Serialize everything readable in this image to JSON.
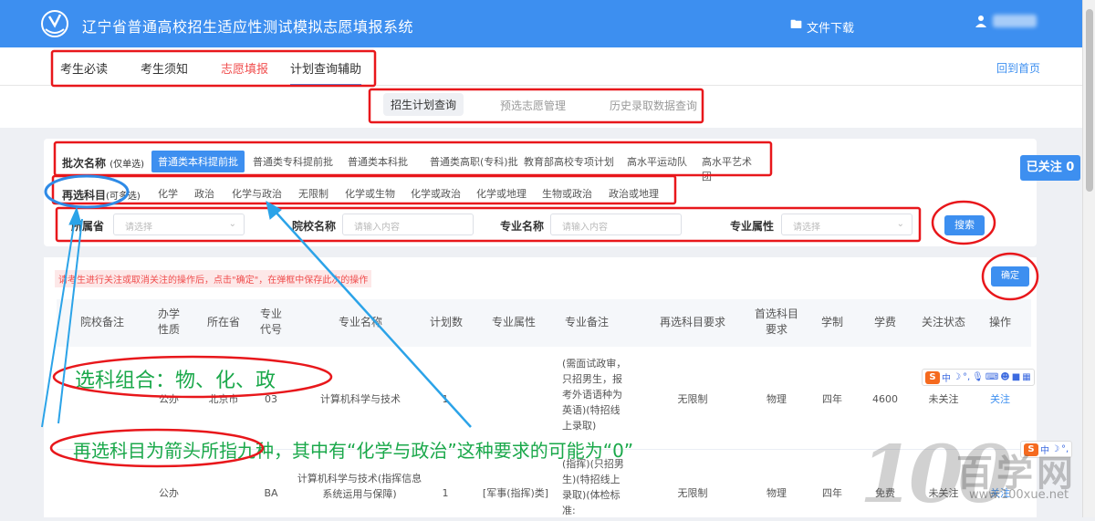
{
  "header": {
    "title": "辽宁省普通高校招生适应性测试模拟志愿填报系统",
    "file_download": "文件下载",
    "home_link": "回到首页"
  },
  "nav": {
    "items": [
      {
        "label": "考生必读"
      },
      {
        "label": "考生须知"
      },
      {
        "label": "志愿填报"
      },
      {
        "label": "计划查询辅助"
      }
    ]
  },
  "subnav": {
    "tabs": [
      {
        "label": "招生计划查询"
      },
      {
        "label": "预选志愿管理"
      },
      {
        "label": "历史录取数据查询"
      }
    ]
  },
  "filters": {
    "batch_label": "批次名称",
    "batch_hint": "(仅单选)",
    "batches": [
      "普通类本科提前批",
      "普通类专科提前批",
      "普通类本科批",
      "普通类高职(专科)批",
      "教育部高校专项计划",
      "高水平运动队",
      "高水平艺术团"
    ],
    "subject_label": "再选科目",
    "subject_hint": "(可多选)",
    "subjects": [
      "化学",
      "政治",
      "化学与政治",
      "无限制",
      "化学或生物",
      "化学或政治",
      "化学或地理",
      "生物或政治",
      "政治或地理"
    ],
    "province_label": "所属省",
    "province_placeholder": "请选择",
    "school_label": "院校名称",
    "school_placeholder": "请输入内容",
    "major_label": "专业名称",
    "major_placeholder": "请输入内容",
    "attr_label": "专业属性",
    "attr_placeholder": "请选择",
    "search_label": "搜索"
  },
  "follow_badge": "已关注 0",
  "notice": "请考生进行关注或取消关注的操作后，点击\"确定\"，在弹框中保存此次的操作",
  "confirm_label": "确定",
  "table": {
    "headers": [
      "院校备注",
      "办学性质",
      "所在省",
      "专业代号",
      "专业名称",
      "计划数",
      "专业属性",
      "专业备注",
      "再选科目要求",
      "首选科目要求",
      "学制",
      "学费",
      "关注状态",
      "操作"
    ],
    "rows": [
      {
        "nature": "公办",
        "province": "北京市",
        "code": "03",
        "major": "计算机科学与技术",
        "plan": "1",
        "attr": "",
        "note": "(需面试政审，只招男生，报考外语语种为英语)(特招线上录取)",
        "reselect": "无限制",
        "first": "物理",
        "years": "四年",
        "fee": "4600",
        "status": "未关注",
        "action": "关注"
      },
      {
        "nature": "公办",
        "province": "",
        "code": "BA",
        "major": "计算机科学与技术(指挥信息系统运用与保障)",
        "plan": "1",
        "attr": "[军事(指挥)类]",
        "note": "(指挥)(只招男生)(特招线上录取)(体检标准:",
        "reselect": "无限制",
        "first": "物理",
        "years": "四年",
        "fee": "免费",
        "status": "未关注",
        "action": "关注"
      }
    ]
  },
  "annotations": {
    "combo": "选科组合：物、化、政",
    "explain": "再选科目为箭头所指九种，其中有“化学与政治”这种要求的可能为“0”"
  },
  "ime": {
    "mode": "中"
  },
  "watermark": {
    "number": "100",
    "text": "百学网",
    "url": "www.100xue.net"
  },
  "colors": {
    "primary": "#3d8ff0",
    "red_mark": "#e8171b",
    "annotation": "#1aa84a"
  }
}
